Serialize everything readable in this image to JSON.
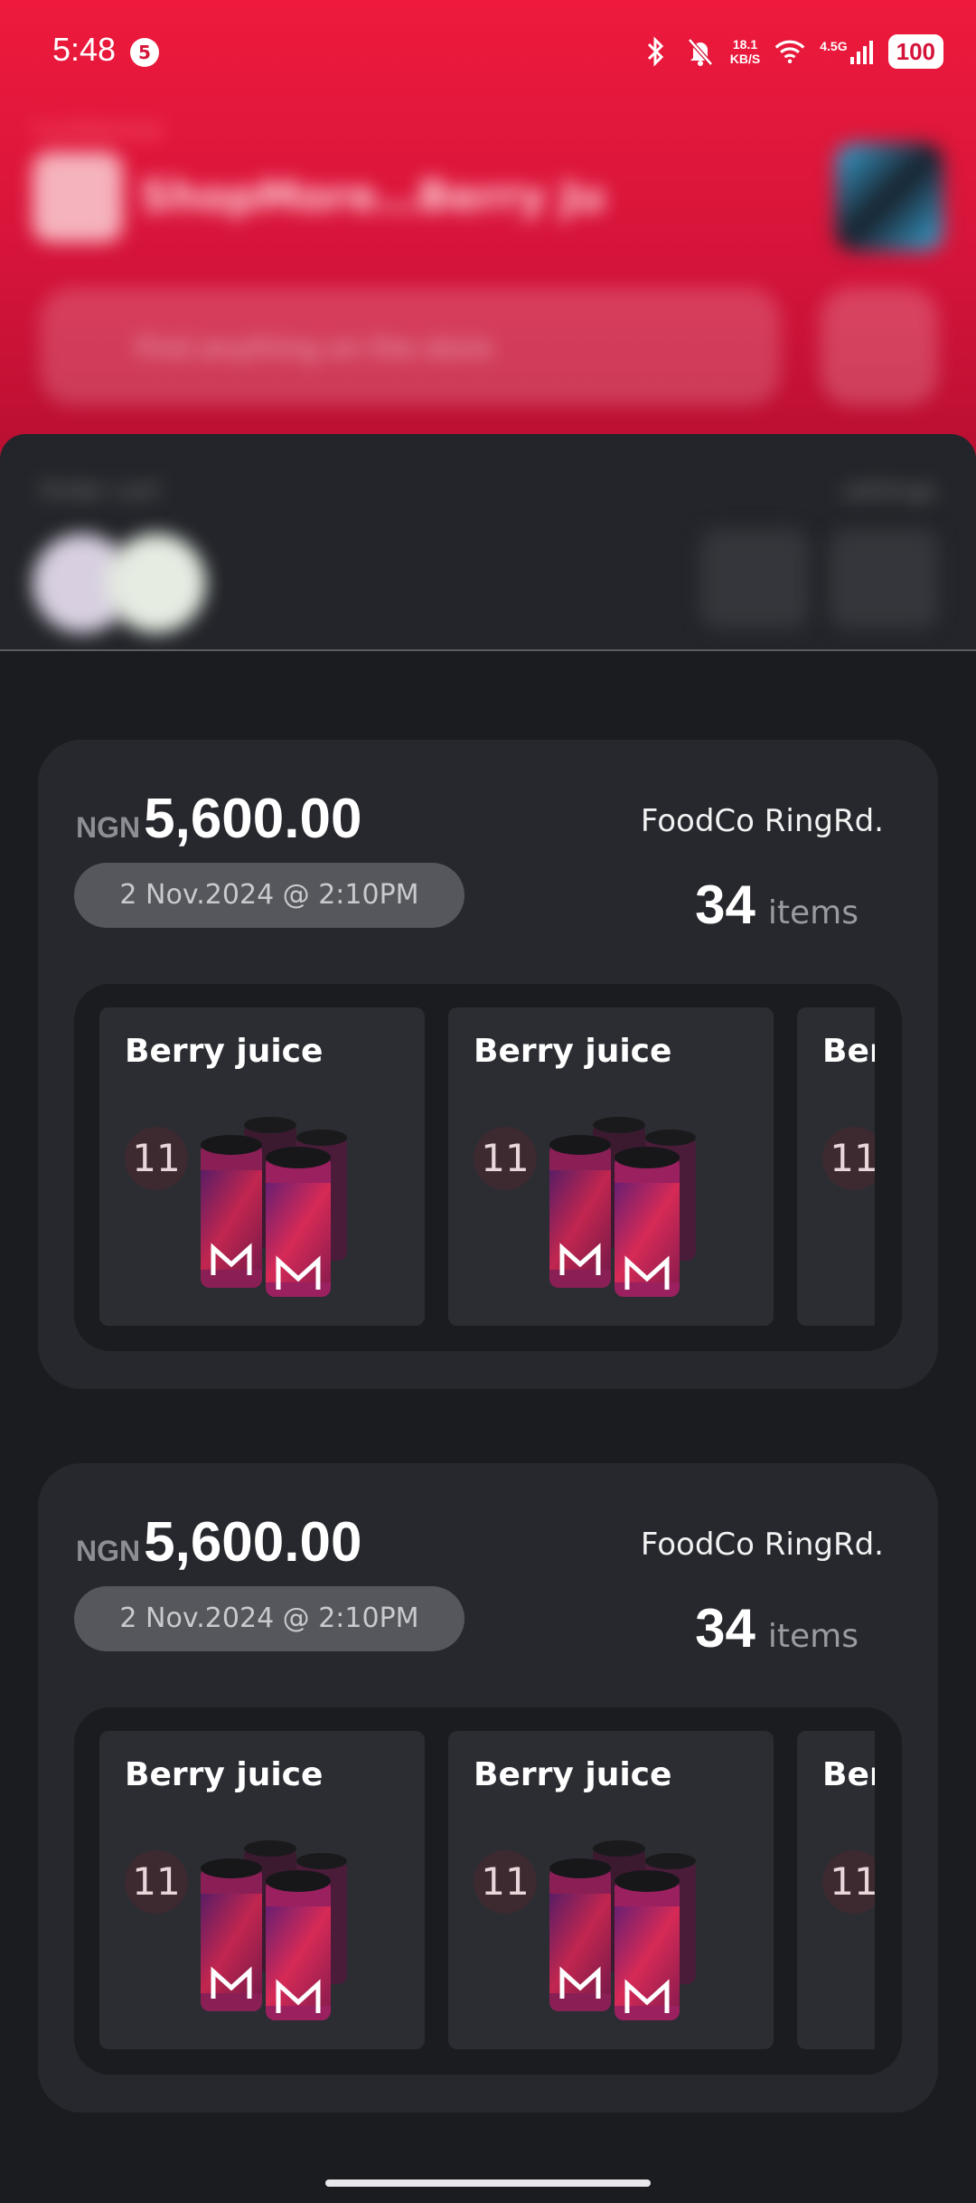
{
  "status_bar": {
    "time": "5:48",
    "notification_count": "5",
    "net_speed_value": "18.1",
    "net_speed_unit": "KB/S",
    "network_type": "4.5G",
    "battery": "100"
  },
  "header_blurred": {
    "small_label": "Confidential",
    "brand_text": "ShopMore…Berry Ju",
    "search_placeholder": "Find anything on the store"
  },
  "strip_blurred": {
    "left_label": "Order cart",
    "right_label": "settings"
  },
  "orders": [
    {
      "currency": "NGN",
      "amount": "5,600.00",
      "date": "2 Nov.2024 @ 2:10PM",
      "store": "FoodCo RingRd.",
      "item_count": "34",
      "items_label": "items",
      "items": [
        {
          "name": "Berry juice",
          "qty": "11"
        },
        {
          "name": "Berry juice",
          "qty": "11"
        },
        {
          "name": "Berry juice",
          "qty": "11"
        }
      ]
    },
    {
      "currency": "NGN",
      "amount": "5,600.00",
      "date": "2 Nov.2024 @ 2:10PM",
      "store": "FoodCo RingRd.",
      "item_count": "34",
      "items_label": "items",
      "items": [
        {
          "name": "Berry juice",
          "qty": "11"
        },
        {
          "name": "Berry juice",
          "qty": "11"
        },
        {
          "name": "Berry juice",
          "qty": "11"
        }
      ]
    }
  ],
  "colors": {
    "header_red": "#ee1a3d",
    "background": "#1b1c20",
    "card": "#26282d"
  }
}
